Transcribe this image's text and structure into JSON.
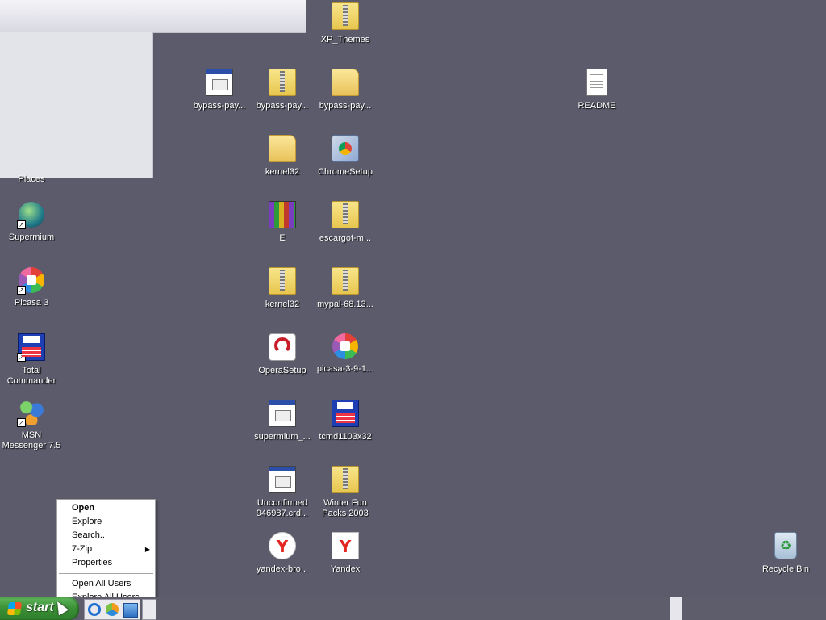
{
  "desktop": {
    "icons": {
      "places": {
        "label": "Places"
      },
      "supermium": {
        "label": "Supermium",
        "icon": "supermium-globe-icon"
      },
      "picasa3": {
        "label": "Picasa 3",
        "icon": "picasa-icon"
      },
      "total_commander": {
        "label": "Total\nCommander",
        "icon": "floppy-disk-icon"
      },
      "msn_messenger": {
        "label": "MSN\nMessenger 7.5",
        "icon": "msn-messenger-icon"
      },
      "xp_themes": {
        "label": "XP_Themes",
        "icon": "zip-folder-icon"
      },
      "bypass_pay_1": {
        "label": "bypass-pay...",
        "icon": "exe-icon"
      },
      "bypass_pay_2": {
        "label": "bypass-pay...",
        "icon": "zip-folder-icon"
      },
      "bypass_pay_3": {
        "label": "bypass-pay...",
        "icon": "folder-icon"
      },
      "readme": {
        "label": "README",
        "icon": "text-document-icon"
      },
      "kernel32_folder": {
        "label": "kernel32",
        "icon": "folder-icon"
      },
      "chrome_setup": {
        "label": "ChromeSetup",
        "icon": "chrome-setup-icon"
      },
      "e_archive": {
        "label": "E",
        "icon": "winrar-archive-icon"
      },
      "escargot": {
        "label": "escargot-m...",
        "icon": "zip-folder-icon"
      },
      "kernel32_zip": {
        "label": "kernel32",
        "icon": "zip-folder-icon"
      },
      "mypal": {
        "label": "mypal-68.13...",
        "icon": "zip-folder-icon"
      },
      "opera_setup": {
        "label": "OperaSetup",
        "icon": "opera-icon"
      },
      "picasa_installer": {
        "label": "picasa-3-9-1...",
        "icon": "picasa-icon"
      },
      "supermium_installer": {
        "label": "supermium_...",
        "icon": "installer-icon"
      },
      "tcmd": {
        "label": "tcmd1103x32",
        "icon": "floppy-disk-icon"
      },
      "unconfirmed": {
        "label": "Unconfirmed\n946987.crd...",
        "icon": "exe-icon"
      },
      "winter_fun": {
        "label": "Winter Fun\nPacks 2003",
        "icon": "zip-folder-icon"
      },
      "yandex_bro": {
        "label": "yandex-bro...",
        "icon": "yandex-browser-icon"
      },
      "yandex": {
        "label": "Yandex",
        "icon": "yandex-icon"
      },
      "recycle_bin": {
        "label": "Recycle Bin",
        "icon": "recycle-bin-icon"
      }
    }
  },
  "context_menu": {
    "items": [
      {
        "label": "Open",
        "default": true
      },
      {
        "label": "Explore"
      },
      {
        "label": "Search..."
      },
      {
        "label": "7-Zip",
        "submenu": true
      },
      {
        "label": "Properties"
      },
      {
        "label": "Open All Users"
      },
      {
        "label": "Explore All Users"
      }
    ]
  },
  "taskbar": {
    "start_label": "start"
  },
  "colors": {
    "desktop_background": "#5b5b6b",
    "start_button": "#3a8f35"
  }
}
